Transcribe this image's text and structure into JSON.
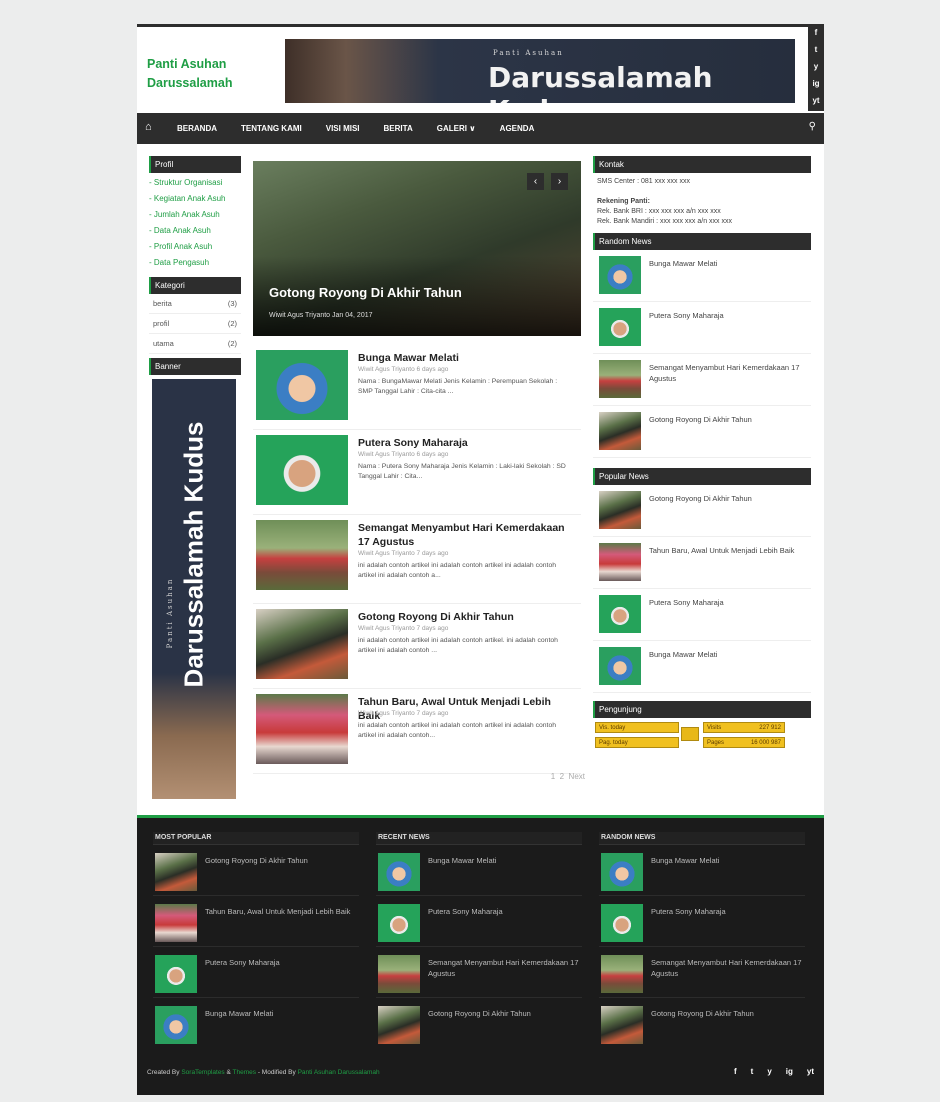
{
  "site": {
    "title_line1": "Panti Asuhan",
    "title_line2": "Darussalamah"
  },
  "header_banner": {
    "subtitle": "Panti Asuhan",
    "title": "Darussalamah Kudus"
  },
  "social": [
    "f",
    "t",
    "y",
    "ig",
    "yt"
  ],
  "nav": {
    "home_icon": "home-icon",
    "items": [
      "BERANDA",
      "TENTANG KAMI",
      "VISI MISI",
      "BERITA",
      "GALERI ∨",
      "AGENDA"
    ],
    "search_icon": "search-icon"
  },
  "left_sidebar": {
    "profil_title": "Profil",
    "profil_items": [
      "- Struktur Organisasi",
      "- Kegiatan Anak Asuh",
      "- Jumlah Anak Asuh",
      "- Data Anak Asuh",
      "- Profil Anak Asuh",
      "- Data Pengasuh"
    ],
    "kategori_title": "Kategori",
    "kategori": [
      {
        "name": "berita",
        "count": "(3)"
      },
      {
        "name": "profil",
        "count": "(2)"
      },
      {
        "name": "utama",
        "count": "(2)"
      }
    ],
    "banner_title": "Banner",
    "banner_subtitle": "Panti Asuhan",
    "banner_text": "Darussalamah Kudus"
  },
  "slider": {
    "title": "Gotong Royong Di Akhir Tahun",
    "meta": "Wiwit Agus Triyanto   Jan 04, 2017",
    "prev": "‹",
    "next": "›"
  },
  "posts": [
    {
      "title": "Bunga Mawar Melati",
      "meta": "Wiwit Agus Triyanto   6 days ago",
      "excerpt": "Nama : BungaMawar Melati Jenis Kelamin : Perempuan Sekolah : SMP Tanggal Lahir : Cita-cita ..."
    },
    {
      "title": "Putera Sony Maharaja",
      "meta": "Wiwit Agus Triyanto   6 days ago",
      "excerpt": "Nama : Putera Sony Maharaja Jenis Kelamin : Laki-laki Sekolah : SD Tanggal Lahir : Cita..."
    },
    {
      "title": "Semangat Menyambut Hari Kemerdakaan 17 Agustus",
      "meta": "Wiwit Agus Triyanto   7 days ago",
      "excerpt": "ini adalah contoh artikel ini adalah contoh artikel ini adalah contoh artikel ini adalah contoh a..."
    },
    {
      "title": "Gotong Royong Di Akhir Tahun",
      "meta": "Wiwit Agus Triyanto   7 days ago",
      "excerpt": "ini adalah contoh artikel ini adalah contoh artikel. ini adalah contoh artikel ini adalah contoh ..."
    },
    {
      "title": "Tahun Baru, Awal Untuk Menjadi Lebih Baik",
      "meta": "Wiwit Agus Triyanto   7 days ago",
      "excerpt": "ini adalah contoh artikel ini adalah contoh artikel ini adalah contoh artikel ini adalah contoh..."
    }
  ],
  "pager": {
    "p1": "1",
    "p2": "2",
    "next": "Next"
  },
  "right_sidebar": {
    "kontak_title": "Kontak",
    "sms": "SMS Center : 081 xxx xxx xxx",
    "rekening_title": "Rekening Panti:",
    "bri": "Rek. Bank BRI : xxx xxx xxx a/n xxx xxx",
    "mandiri": "Rek. Bank Mandiri : xxx xxx xxx a/n xxx xxx",
    "random_title": "Random News",
    "random": [
      "Bunga Mawar Melati",
      "Putera Sony Maharaja",
      "Semangat Menyambut Hari Kemerdakaan 17 Agustus",
      "Gotong Royong Di Akhir Tahun"
    ],
    "popular_title": "Popular News",
    "popular": [
      "Gotong Royong Di Akhir Tahun",
      "Tahun Baru, Awal Untuk Menjadi Lebih Baik",
      "Putera Sony Maharaja",
      "Bunga Mawar Melati"
    ],
    "pengunjung_title": "Pengunjung",
    "counter": {
      "vis_today": "Vis. today",
      "pag_today": "Pag. today",
      "visits_label": "Visits",
      "visits": "227 912",
      "pages_label": "Pages",
      "pages": "16 000 987"
    }
  },
  "footer": {
    "most_popular_title": "MOST POPULAR",
    "most_popular": [
      "Gotong Royong Di Akhir Tahun",
      "Tahun Baru, Awal Untuk Menjadi Lebih Baik",
      "Putera Sony Maharaja",
      "Bunga Mawar Melati"
    ],
    "recent_title": "RECENT NEWS",
    "recent": [
      "Bunga Mawar Melati",
      "Putera Sony Maharaja",
      "Semangat Menyambut Hari Kemerdakaan 17 Agustus",
      "Gotong Royong Di Akhir Tahun"
    ],
    "random_title": "RANDOM NEWS",
    "random": [
      "Bunga Mawar Melati",
      "Putera Sony Maharaja",
      "Semangat Menyambut Hari Kemerdakaan 17 Agustus",
      "Gotong Royong Di Akhir Tahun"
    ],
    "created_by": "Created By ",
    "soratemplates": "SoraTemplates",
    "amp": " & ",
    "themes": "Themes",
    "modified": " - Modified By ",
    "modifier": "Panti Asuhan Darussalamah",
    "social": [
      "f",
      "t",
      "y",
      "ig",
      "yt"
    ]
  },
  "colors": {
    "accent": "#1f9e45",
    "dark": "#2d2d2d",
    "footer_bg": "#1b1b1b"
  }
}
